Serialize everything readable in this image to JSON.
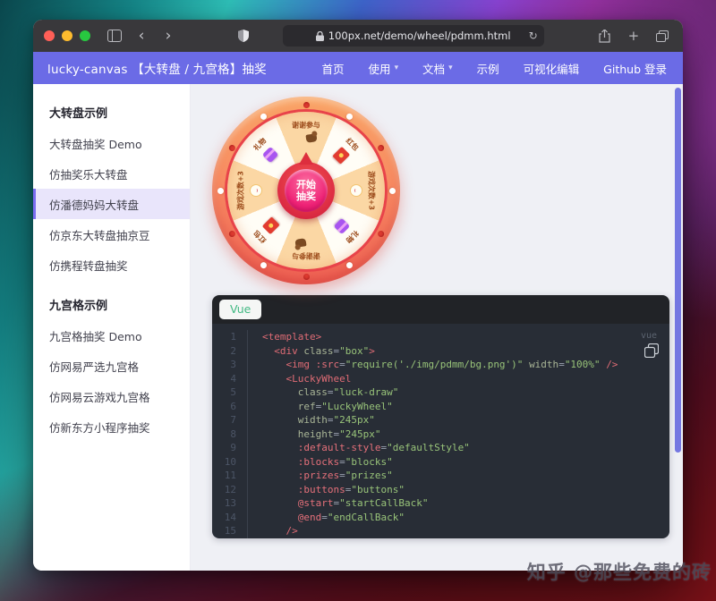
{
  "browser": {
    "url": "100px.net/demo/wheel/pdmm.html",
    "refresh_icon": "↻"
  },
  "navbar": {
    "title": "lucky-canvas 【大转盘 / 九宫格】抽奖",
    "items": [
      {
        "label": "首页",
        "dropdown": false
      },
      {
        "label": "使用",
        "dropdown": true
      },
      {
        "label": "文档",
        "dropdown": true
      },
      {
        "label": "示例",
        "dropdown": false
      },
      {
        "label": "可视化编辑",
        "dropdown": false
      },
      {
        "label": "Github 登录",
        "dropdown": false
      }
    ],
    "dropdown_arrow": "▾"
  },
  "sidebar": {
    "groups": [
      {
        "header": "大转盘示例",
        "items": [
          {
            "label": "大转盘抽奖 Demo",
            "selected": false
          },
          {
            "label": "仿抽奖乐大转盘",
            "selected": false
          },
          {
            "label": "仿潘德妈妈大转盘",
            "selected": true
          },
          {
            "label": "仿京东大转盘抽京豆",
            "selected": false
          },
          {
            "label": "仿携程转盘抽奖",
            "selected": false
          }
        ]
      },
      {
        "header": "九宫格示例",
        "items": [
          {
            "label": "九宫格抽奖 Demo",
            "selected": false
          },
          {
            "label": "仿网易严选九宫格",
            "selected": false
          },
          {
            "label": "仿网易云游戏九宫格",
            "selected": false
          },
          {
            "label": "仿新东方小程序抽奖",
            "selected": false
          }
        ]
      }
    ]
  },
  "wheel": {
    "center_button": {
      "line1": "开始",
      "line2": "抽奖"
    },
    "sectors": [
      {
        "label": "谢谢参与",
        "icon": "thanks-icon",
        "rotation": 0
      },
      {
        "label": "红包",
        "icon": "red-envelope-icon",
        "rotation": 45
      },
      {
        "label": "游戏次数+3",
        "icon": "coin-icon",
        "rotation": 90
      },
      {
        "label": "礼物",
        "icon": "gift-icon",
        "rotation": 135
      },
      {
        "label": "谢谢参与",
        "icon": "thanks-icon",
        "rotation": 180
      },
      {
        "label": "红包",
        "icon": "red-envelope-icon",
        "rotation": 225
      },
      {
        "label": "游戏次数+3",
        "icon": "coin-icon",
        "rotation": 270
      },
      {
        "label": "礼物",
        "icon": "gift-icon",
        "rotation": 315
      }
    ]
  },
  "code": {
    "tab_label": "Vue",
    "lang_badge": "vue",
    "lines": [
      {
        "n": "1",
        "tokens": [
          [
            "<template>",
            "tag"
          ]
        ]
      },
      {
        "n": "2",
        "tokens": [
          [
            "  ",
            "pln"
          ],
          [
            "<div",
            "tag"
          ],
          [
            " ",
            "pln"
          ],
          [
            "class",
            "attr"
          ],
          [
            "=",
            "eq"
          ],
          [
            "\"box\"",
            "str"
          ],
          [
            ">",
            "tag"
          ]
        ]
      },
      {
        "n": "3",
        "tokens": [
          [
            "    ",
            "pln"
          ],
          [
            "<img",
            "tag"
          ],
          [
            " ",
            "pln"
          ],
          [
            ":src",
            "dir"
          ],
          [
            "=",
            "eq"
          ],
          [
            "\"require('./img/pdmm/bg.png')\"",
            "str"
          ],
          [
            " ",
            "pln"
          ],
          [
            "width",
            "attr"
          ],
          [
            "=",
            "eq"
          ],
          [
            "\"100%\"",
            "str"
          ],
          [
            " ",
            "pln"
          ],
          [
            "/>",
            "tag"
          ]
        ]
      },
      {
        "n": "4",
        "tokens": [
          [
            "    ",
            "pln"
          ],
          [
            "<LuckyWheel",
            "tag"
          ]
        ]
      },
      {
        "n": "5",
        "tokens": [
          [
            "      ",
            "pln"
          ],
          [
            "class",
            "attr"
          ],
          [
            "=",
            "eq"
          ],
          [
            "\"luck-draw\"",
            "str"
          ]
        ]
      },
      {
        "n": "6",
        "tokens": [
          [
            "      ",
            "pln"
          ],
          [
            "ref",
            "attr"
          ],
          [
            "=",
            "eq"
          ],
          [
            "\"LuckyWheel\"",
            "str"
          ]
        ]
      },
      {
        "n": "7",
        "tokens": [
          [
            "      ",
            "pln"
          ],
          [
            "width",
            "attr"
          ],
          [
            "=",
            "eq"
          ],
          [
            "\"245px\"",
            "str"
          ]
        ]
      },
      {
        "n": "8",
        "tokens": [
          [
            "      ",
            "pln"
          ],
          [
            "height",
            "attr"
          ],
          [
            "=",
            "eq"
          ],
          [
            "\"245px\"",
            "str"
          ]
        ]
      },
      {
        "n": "9",
        "tokens": [
          [
            "      ",
            "pln"
          ],
          [
            ":default-style",
            "dir"
          ],
          [
            "=",
            "eq"
          ],
          [
            "\"defaultStyle\"",
            "str"
          ]
        ]
      },
      {
        "n": "10",
        "tokens": [
          [
            "      ",
            "pln"
          ],
          [
            ":blocks",
            "dir"
          ],
          [
            "=",
            "eq"
          ],
          [
            "\"blocks\"",
            "str"
          ]
        ]
      },
      {
        "n": "11",
        "tokens": [
          [
            "      ",
            "pln"
          ],
          [
            ":prizes",
            "dir"
          ],
          [
            "=",
            "eq"
          ],
          [
            "\"prizes\"",
            "str"
          ]
        ]
      },
      {
        "n": "12",
        "tokens": [
          [
            "      ",
            "pln"
          ],
          [
            ":buttons",
            "dir"
          ],
          [
            "=",
            "eq"
          ],
          [
            "\"buttons\"",
            "str"
          ]
        ]
      },
      {
        "n": "13",
        "tokens": [
          [
            "      ",
            "pln"
          ],
          [
            "@start",
            "dir"
          ],
          [
            "=",
            "eq"
          ],
          [
            "\"startCallBack\"",
            "str"
          ]
        ]
      },
      {
        "n": "14",
        "tokens": [
          [
            "      ",
            "pln"
          ],
          [
            "@end",
            "dir"
          ],
          [
            "=",
            "eq"
          ],
          [
            "\"endCallBack\"",
            "str"
          ]
        ]
      },
      {
        "n": "15",
        "tokens": [
          [
            "    ",
            "pln"
          ],
          [
            "/>",
            "tag"
          ]
        ]
      }
    ]
  },
  "watermark": "知乎 @那些免费的砖",
  "colors": {
    "navbar": "#6b6be6",
    "accent_purple": "#7a6cf0",
    "code_bg": "#282d36",
    "vue_green": "#42b983",
    "wheel_rim": "#f78b62",
    "wheel_peach": "#fbd7a4",
    "center_pink": "#ef2377"
  }
}
